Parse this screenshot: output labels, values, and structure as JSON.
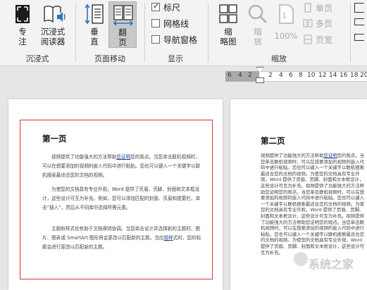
{
  "ribbon": {
    "immersive": {
      "label": "沉浸式",
      "focus": "专\n注",
      "reader": "沉浸式\n阅读器"
    },
    "page_move": {
      "label": "页面移动",
      "vertical": "垂\n直",
      "flip": "翻\n页"
    },
    "show": {
      "label": "显示",
      "ruler": "标尺",
      "gridlines": "网格线",
      "nav_pane": "导航窗格",
      "ruler_checked": true,
      "gridlines_checked": false,
      "nav_pane_checked": false
    },
    "zoom": {
      "label": "缩放",
      "thumbnails": "缩\n略图",
      "zoom_btn": "缩\n放",
      "hundred": "100%",
      "single_page": "单页",
      "multi_page": "多页",
      "page_width": "页宽"
    }
  },
  "ruler": {
    "ticks": [
      "6",
      "4",
      "2",
      "2",
      "4",
      "6",
      "8",
      "10",
      "12",
      "14",
      "16",
      "18",
      "20"
    ]
  },
  "document": {
    "page1": {
      "title": "第一页",
      "para1_a": "视频提供了功能强大的方法帮助",
      "para1_link": "您证明",
      "para1_b": "您的观点。当您单击联机视频时，可以在想要添加的视频的嵌入代码中进行粘贴。您也可以键入一个关键字以联机搜索最适合您的文档的视频。",
      "para2": "为使您的文档具有专业外观，Word 提供了页眉、页脚、封面和文本框设计，这些设计可互为补充。例如，您可以添加匹配的封面、页眉和提要栏。单击“插入”，然后从不同库中选择所需元素。",
      "para3_a": "主题和样式也有助于文档保持协调。当您单击设计并选择新的主题时，图片、图表或 SmartArt 图形将会更改以匹配新的主题。当应",
      "para3_link": "用样",
      "para3_b": "式时，您的标题会进行更改以匹配新的主题。"
    },
    "page2": {
      "title": "第二页",
      "text_a": "视频提供了功能强大的方法帮助",
      "text_link": "您证明",
      "text_b": "您的观点。当您单击联机视频时，可以在想要添加的视频的嵌入代码中进行粘贴。您也可以键入一个关键字以联机搜索最适合您的文档的视频。为使您的文档具有专业外观，Word 提供了页眉、页脚、封面和文本框设计，这些设计可互为补充。",
      "text_c": "视频提供了功能强大的方法帮助您证明您的观点。当您单击联机视频时，可以在想要添加的视频的嵌入代码中进行粘贴。您也可以键入一个关键字以联机搜索最适合您的文档的视频。为使您的文档具有专业外观，Word 提供了页眉、页脚、封面和文本框设计，这些设计可互为补充。",
      "text_d": "视频提供了功能强大的方法帮助您证明您的观点。当您单击联机视频时，可以在想要添加的视频的嵌入代码中进行粘贴。您也可以键入一个关键字以联机搜索最适合您的文档的视频。为使您的文档具有专业外观，Word 提供了页眉、页脚、封面和文本框设计，这些设计可互为补充。"
    }
  },
  "watermark": "系统之家"
}
